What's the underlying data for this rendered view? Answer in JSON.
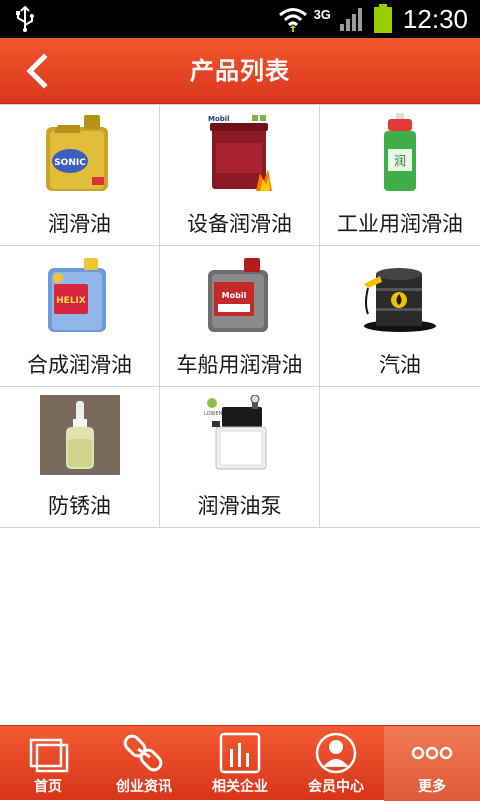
{
  "status_bar": {
    "network": "3G",
    "time": "12:30",
    "icons": [
      "usb-icon",
      "wifi-icon",
      "signal-icon",
      "battery-icon"
    ]
  },
  "header": {
    "title": "产品列表",
    "back_icon": "chevron-left-icon"
  },
  "products": [
    {
      "label": "润滑油",
      "image": "oil-can-gold"
    },
    {
      "label": "设备润滑油",
      "image": "red-pail"
    },
    {
      "label": "工业用润滑油",
      "image": "green-spray-can"
    },
    {
      "label": "合成润滑油",
      "image": "blue-oil-can"
    },
    {
      "label": "车船用润滑油",
      "image": "grey-oil-can"
    },
    {
      "label": "汽油",
      "image": "oil-barrel"
    },
    {
      "label": "防锈油",
      "image": "dropper-bottle"
    },
    {
      "label": "润滑油泵",
      "image": "lubrication-pump"
    }
  ],
  "bottom_nav": [
    {
      "label": "首页",
      "icon": "home-icon",
      "active": false
    },
    {
      "label": "创业资讯",
      "icon": "link-icon",
      "active": false
    },
    {
      "label": "相关企业",
      "icon": "bar-chart-icon",
      "active": false
    },
    {
      "label": "会员中心",
      "icon": "user-icon",
      "active": false
    },
    {
      "label": "更多",
      "icon": "more-icon",
      "active": true
    }
  ],
  "colors": {
    "header": "#e54a25",
    "status_bar": "#000000",
    "battery": "#99cc00"
  }
}
